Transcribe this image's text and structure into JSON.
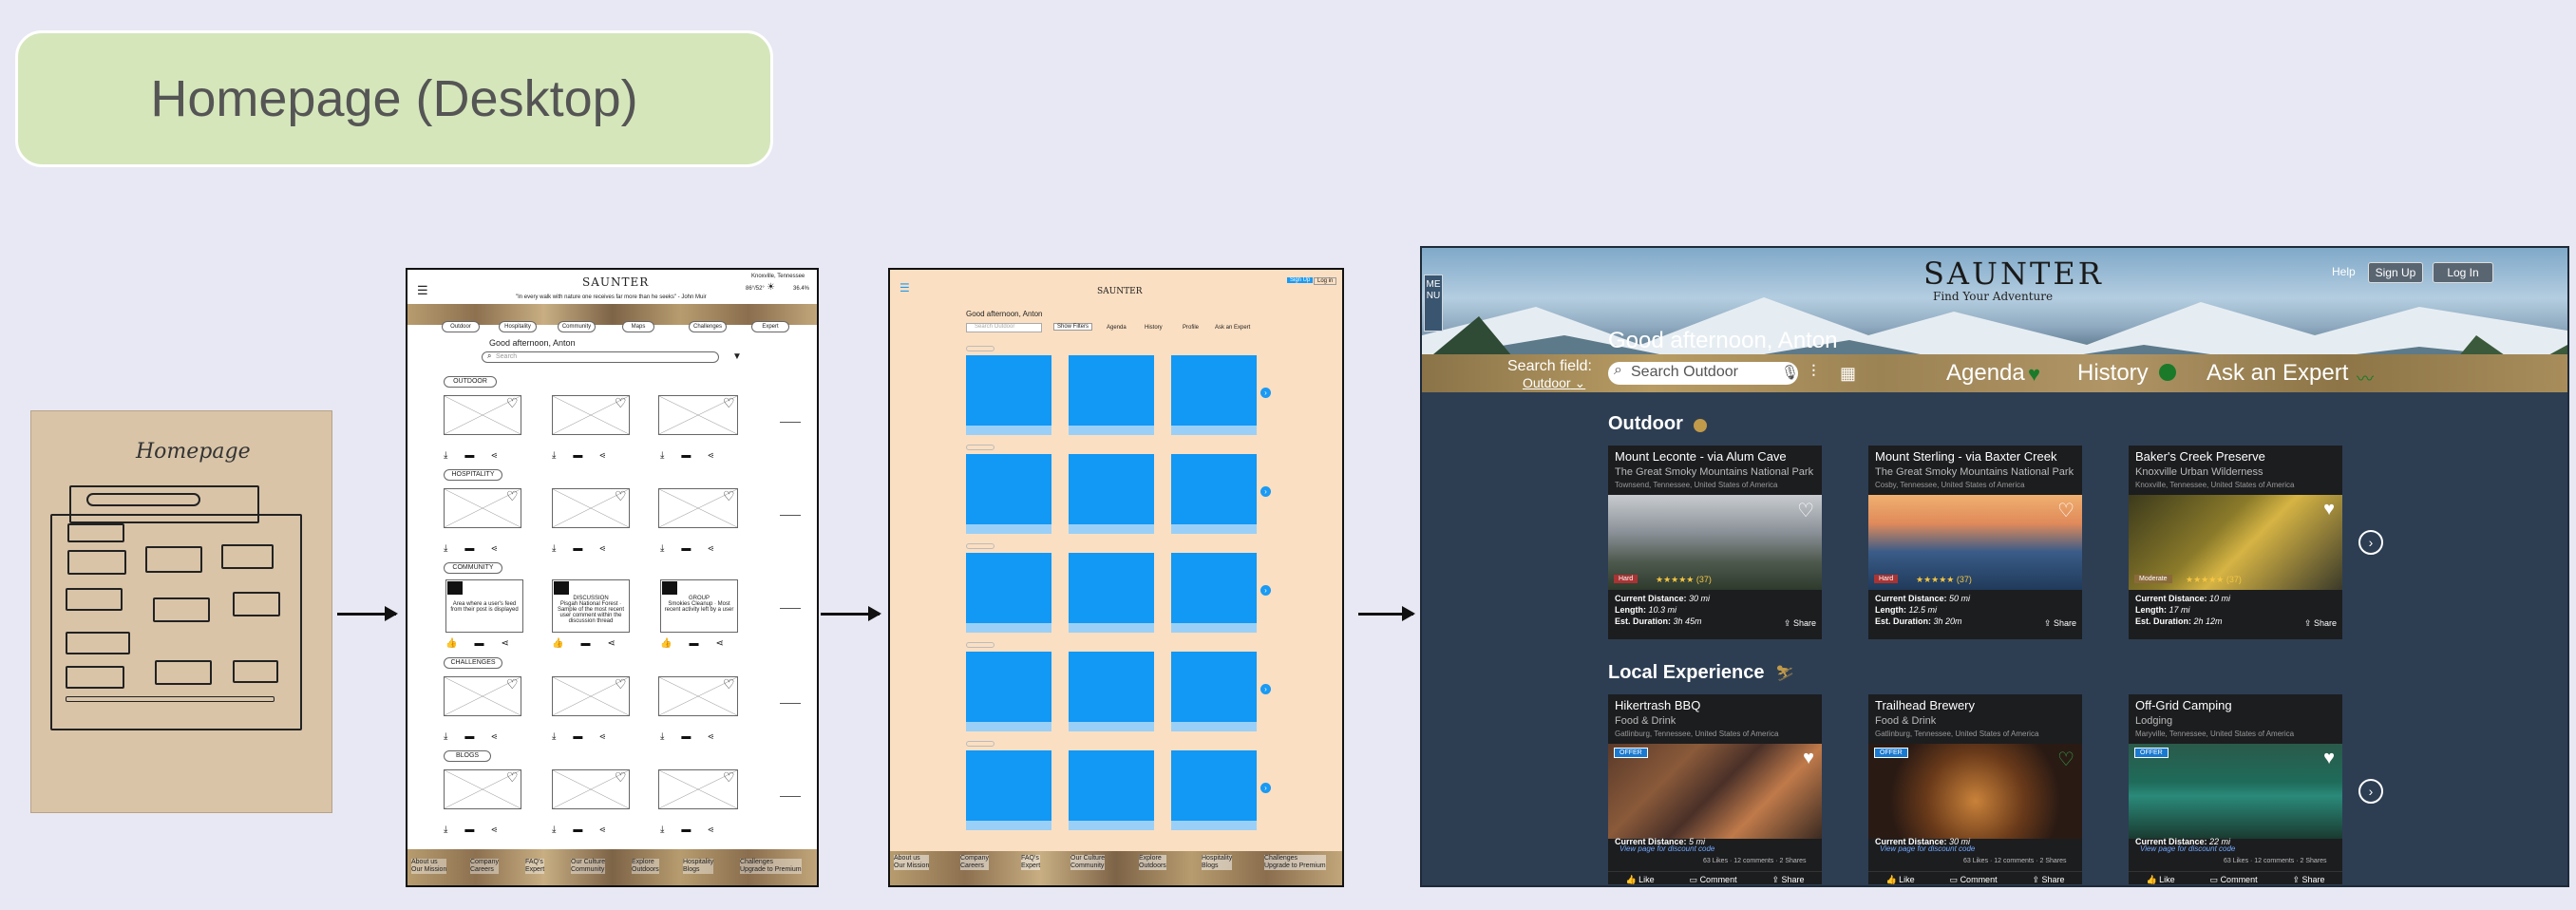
{
  "page_title": "Homepage (Desktop)",
  "sketch": {
    "title": "Homepage",
    "search_word": "Search"
  },
  "wireframe": {
    "brand": "SAUNTER",
    "location": "Knoxville, Tennessee",
    "quote": "\"In every walk with nature one receives far more than he seeks\" - John Muir",
    "weather": "86°/52°",
    "humidity": "36.4%",
    "tabs": [
      "Outdoor",
      "Hospitality",
      "Community",
      "Maps",
      "Challenges",
      "Expert"
    ],
    "greeting": "Good afternoon, Anton",
    "search_placeholder": "Search",
    "sections": [
      "OUTDOOR",
      "HOSPITALITY",
      "COMMUNITY",
      "CHALLENGES",
      "BLOGS"
    ],
    "community": [
      {
        "head": "",
        "body": "Area where a user's feed from their post is displayed"
      },
      {
        "head": "DISCUSSION",
        "body": "Pisgah National Forest · Sample of the most recent user comment within the discussion thread"
      },
      {
        "head": "GROUP",
        "body": "Smokies Cleanup · Most recent activity left by a user"
      }
    ],
    "footer": [
      "About us",
      "Our Mission",
      "Company",
      "Careers",
      "FAQ's",
      "Expert",
      "Our Culture",
      "Community",
      "Explore",
      "Outdoors",
      "Hospitality",
      "Blogs",
      "Challenges",
      "Upgrade to Premium"
    ]
  },
  "mockup": {
    "brand": "SAUNTER",
    "signup": "Sign Up",
    "login": "Log in",
    "greeting": "Good afternoon, Anton",
    "search_placeholder": "Search Outdoor",
    "filters": "Show Filters",
    "nav": [
      "Agenda",
      "History",
      "Profile",
      "Ask an Expert"
    ],
    "footer": [
      "About us",
      "Our Mission",
      "Company",
      "Careers",
      "FAQ's",
      "Expert",
      "Our Culture",
      "Community",
      "Explore",
      "Outdoors",
      "Hospitality",
      "Blogs",
      "Challenges",
      "Upgrade to Premium"
    ]
  },
  "final": {
    "menu": "MENU",
    "brand": "SAUNTER",
    "tagline": "Find Your Adventure",
    "help": "Help",
    "signup": "Sign Up",
    "login": "Log In",
    "greeting": "Good afternoon, Anton",
    "search_field_label": "Search field:",
    "search_field_value": "Outdoor",
    "search_placeholder": "Search Outdoor",
    "nav": [
      "Agenda",
      "History",
      "Ask an Expert"
    ],
    "outdoor_title": "Outdoor",
    "local_title": "Local Experience",
    "outdoor": [
      {
        "title": "Mount Leconte - via Alum Cave",
        "subtitle": "The Great Smoky Mountains National Park",
        "loc": "Townsend, Tennessee, United States of America",
        "tag": "Hard",
        "reviews": "(37)",
        "dist": "30 mi",
        "len": "10.3 mi",
        "dur": "3h 45m"
      },
      {
        "title": "Mount Sterling - via Baxter Creek",
        "subtitle": "The Great Smoky Mountains National Park",
        "loc": "Cosby, Tennessee, United States of America",
        "tag": "Hard",
        "reviews": "(37)",
        "dist": "50 mi",
        "len": "12.5 mi",
        "dur": "3h 20m"
      },
      {
        "title": "Baker's Creek Preserve",
        "subtitle": "Knoxville Urban Wilderness",
        "loc": "Knoxville, Tennessee, United States of America",
        "tag": "Moderate",
        "reviews": "(37)",
        "dist": "10 mi",
        "len": "17 mi",
        "dur": "2h 12m"
      }
    ],
    "local": [
      {
        "title": "Hikertrash BBQ",
        "subtitle": "Food & Drink",
        "loc": "Gatlinburg, Tennessee, United States of America",
        "dist": "5 mi",
        "stats": "63 Likes · 12 comments · 2 Shares"
      },
      {
        "title": "Trailhead Brewery",
        "subtitle": "Food & Drink",
        "loc": "Gatlinburg, Tennessee, United States of America",
        "dist": "30 mi",
        "stats": "63 Likes · 12 comments · 2 Shares"
      },
      {
        "title": "Off-Grid Camping",
        "subtitle": "Lodging",
        "loc": "Maryville, Tennessee, United States of America",
        "dist": "22 mi",
        "stats": "63 Likes · 12 comments · 2 Shares"
      }
    ],
    "labels": {
      "dist": "Current Distance:",
      "len": "Length:",
      "dur": "Est. Duration:",
      "share": "Share",
      "like": "Like",
      "comment": "Comment",
      "discount": "View page for discount code",
      "offer": "OFFER"
    }
  }
}
